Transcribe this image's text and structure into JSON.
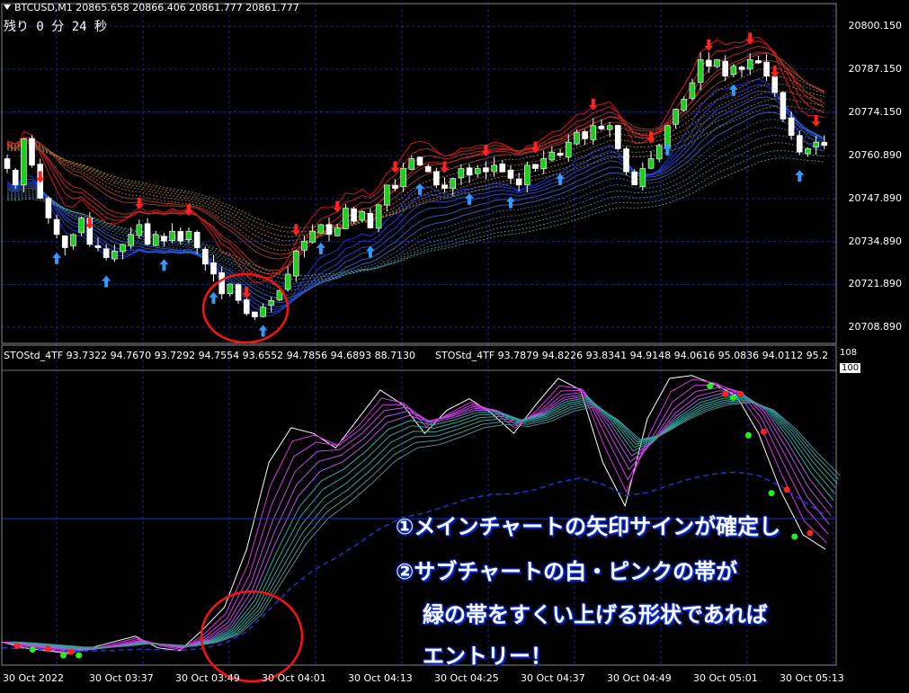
{
  "header": {
    "symbol_line": "BTCUSD,M1  20865.658 20866.406 20861.777 20861.777",
    "countdown": "残り 0 分 24 秒"
  },
  "indicator_header": {
    "left": "STOStd_4TF 93.7322 94.7670 93.7292 94.7554 93.6552 94.7856 94.6893 88.7130",
    "right": "STOStd_4TF 93.7879 94.8226 93.8341 94.9148 94.0616 95.0836 94.0112 95.2"
  },
  "price_axis": [
    "20800.150",
    "20787.150",
    "20774.150",
    "20760.890",
    "20747.890",
    "20734.890",
    "20721.890",
    "20708.890"
  ],
  "sub_axis": {
    "top": "108",
    "level": "100"
  },
  "time_axis": [
    "30 Oct 2022",
    "30 Oct 03:37",
    "30 Oct 03:49",
    "30 Oct 04:01",
    "30 Oct 04:13",
    "30 Oct 04:25",
    "30 Oct 04:37",
    "30 Oct 04:49",
    "30 Oct 05:01",
    "30 Oct 05:13"
  ],
  "annotations": [
    "①メインチャートの矢印サインが確定し",
    "②サブチャートの白・ピンクの帯が",
    "緑の帯をすくい上げる形状であれば",
    "エントリー！"
  ],
  "colors": {
    "bull": "#22cc22",
    "bear": "#ffffff",
    "grid": "#1a2a7a",
    "up_arrow": "#3399ff",
    "down_arrow": "#ff2222",
    "circle": "#ff1111"
  },
  "chart_data": [
    {
      "type": "line",
      "title": "BTCUSD,M1",
      "ylim": [
        20704,
        20807
      ],
      "note": "candlestick price series with moving-average ribbons",
      "close": [
        20757,
        20752,
        20766,
        20758,
        20748,
        20742,
        20737,
        20733,
        20737,
        20742,
        20734,
        20733,
        20730,
        20732,
        20734,
        20737,
        20740,
        20734,
        20737,
        20735,
        20738,
        20735,
        20738,
        20733,
        20728,
        20725,
        20719,
        20722,
        20717,
        20713,
        20712,
        20715,
        20717,
        20720,
        20725,
        20732,
        20735,
        20738,
        20740,
        20737,
        20739,
        20745,
        20741,
        20744,
        20739,
        20746,
        20752,
        20751,
        20757,
        20760,
        20758,
        20756,
        20752,
        20751,
        20754,
        20757,
        20755,
        20757,
        20756,
        20758,
        20756,
        20754,
        20752,
        20758,
        20757,
        20760,
        20762,
        20761,
        20765,
        20768,
        20766,
        20770,
        20769,
        20770,
        20763,
        20756,
        20752,
        20757,
        20760,
        20764,
        20770,
        20775,
        20778,
        20783,
        20790,
        20788,
        20790,
        20785,
        20788,
        20787,
        20790,
        20789,
        20785,
        20780,
        20772,
        20767,
        20762,
        20763,
        20765,
        20764
      ],
      "up_arrows": [
        6,
        12,
        19,
        25,
        31,
        38,
        44,
        50,
        56,
        61,
        67,
        80,
        88,
        96
      ],
      "down_arrows": [
        4,
        10,
        16,
        22,
        29,
        35,
        40,
        47,
        53,
        58,
        64,
        71,
        78,
        85,
        90,
        93,
        98
      ]
    },
    {
      "type": "line",
      "title": "STOStd_4TF",
      "ylim": [
        0,
        108
      ],
      "level": 100,
      "series_shape": [
        8,
        6,
        5,
        4,
        6,
        8,
        10,
        6,
        5,
        12,
        20,
        40,
        70,
        82,
        80,
        75,
        85,
        95,
        90,
        80,
        88,
        92,
        87,
        80,
        90,
        99,
        95,
        70,
        55,
        85,
        99,
        100,
        97,
        93,
        80,
        60,
        45,
        40
      ],
      "green_dots": [
        4,
        8,
        10,
        92,
        95,
        97,
        100,
        103
      ],
      "red_dots": [
        2,
        6,
        9,
        94,
        96,
        99,
        102,
        105
      ]
    }
  ]
}
